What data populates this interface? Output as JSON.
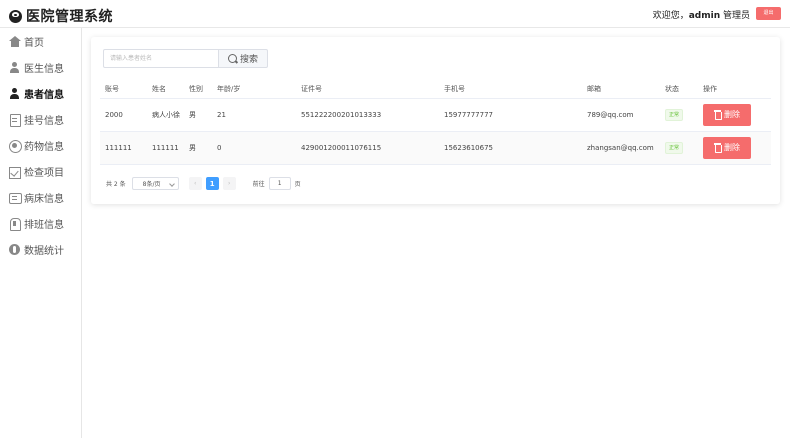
{
  "header": {
    "title": "医院管理系统",
    "welcome_prefix": "欢迎您，",
    "username": "admin",
    "role": " 管理员",
    "logout_label": "退出"
  },
  "sidebar": {
    "items": [
      {
        "label": "首页",
        "icon": "home-icon",
        "active": false
      },
      {
        "label": "医生信息",
        "icon": "doctor-icon",
        "active": false
      },
      {
        "label": "患者信息",
        "icon": "patient-icon",
        "active": true
      },
      {
        "label": "挂号信息",
        "icon": "register-icon",
        "active": false
      },
      {
        "label": "药物信息",
        "icon": "drug-icon",
        "active": false
      },
      {
        "label": "检查项目",
        "icon": "check-icon",
        "active": false
      },
      {
        "label": "病床信息",
        "icon": "bed-icon",
        "active": false
      },
      {
        "label": "排班信息",
        "icon": "schedule-icon",
        "active": false
      },
      {
        "label": "数据统计",
        "icon": "stats-icon",
        "active": false
      }
    ]
  },
  "search": {
    "placeholder": "请输入患者姓名",
    "button_label": "搜索"
  },
  "table": {
    "columns": [
      "账号",
      "姓名",
      "性别",
      "年龄/岁",
      "证件号",
      "手机号",
      "邮箱",
      "状态",
      "操作"
    ],
    "rows": [
      {
        "account": "2000",
        "name": "病人小徐",
        "gender": "男",
        "age": "21",
        "id_number": "551222200201013333",
        "phone": "15977777777",
        "email": "789@qq.com",
        "status": "正常",
        "action": "删除"
      },
      {
        "account": "111111",
        "name": "111111",
        "gender": "男",
        "age": "0",
        "id_number": "429001200011076115",
        "phone": "15623610675",
        "email": "zhangsan@qq.com",
        "status": "正常",
        "action": "删除"
      }
    ]
  },
  "pagination": {
    "total_text": "共 2 条",
    "page_size": "8条/页",
    "prev": "‹",
    "current_page": "1",
    "next": "›",
    "goto_prefix": "前往",
    "goto_value": "1",
    "goto_suffix": "页"
  },
  "colors": {
    "danger": "#f56c6c",
    "primary": "#409eff",
    "success": "#67c23a"
  }
}
